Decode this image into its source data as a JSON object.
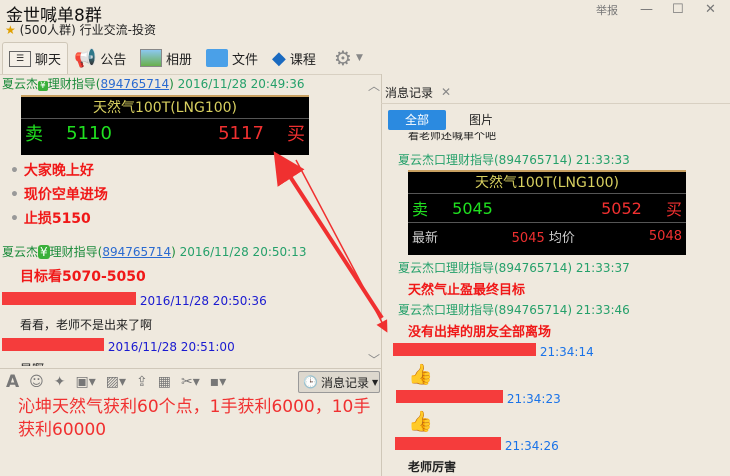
{
  "window": {
    "title": "金世喊单8群",
    "subtitle": "(500人群) 行业交流-投资",
    "report": "举报",
    "minimize": "—",
    "maximize": "☐",
    "close": "✕"
  },
  "toolbar": [
    {
      "label": "聊天",
      "icon": "chat-icon"
    },
    {
      "label": "公告",
      "icon": "megaphone-icon"
    },
    {
      "label": "相册",
      "icon": "album-icon"
    },
    {
      "label": "文件",
      "icon": "folder-icon"
    },
    {
      "label": "课程",
      "icon": "course-icon"
    }
  ],
  "left_chat": {
    "m1": {
      "name": "夏云杰",
      "title": "理财指导",
      "qq": "894765714",
      "time": "2016/11/28 20:49:36"
    },
    "quote1": {
      "title": "天然气100T(LNG100)",
      "sell_label": "卖",
      "sell": "5110",
      "buy": "5117",
      "buy_label": "买"
    },
    "lines1": [
      "大家晚上好",
      "现价空单进场",
      "止损5150"
    ],
    "m2": {
      "name": "夏云杰",
      "title": "理财指导",
      "qq": "894765714",
      "time": "2016/11/28 20:50:13",
      "text": "目标看5070-5050"
    },
    "m3": {
      "time": "2016/11/28 20:50:36",
      "text": "看看，老师不是出来了啊"
    },
    "m4": {
      "time": "2016/11/28 20:51:00",
      "text": "早啊"
    }
  },
  "input_toolbar": {
    "history_label": "消息记录"
  },
  "input_text": "沁坤天然气获利60个点，1手获利6000，10手获利60000",
  "right_panel": {
    "tab_label": "消息记录",
    "filter_all": "全部",
    "filter_images": "图片",
    "cut_text": "看老师还喊单个吧",
    "r1": "夏云杰口理财指导(894765714) 21:33:33",
    "quote2": {
      "title": "天然气100T(LNG100)",
      "sell_label": "卖",
      "sell": "5045",
      "buy": "5052",
      "buy_label": "买",
      "latest_label": "最新",
      "latest": "5045",
      "avg_label": "均价",
      "avg": "5048"
    },
    "r2": "夏云杰口理财指导(894765714) 21:33:37",
    "r2_text": "天然气止盈最终目标",
    "r3": "夏云杰口理财指导(894765714) 21:33:46",
    "r3_text": "没有出掉的朋友全部离场",
    "r4_time": "21:34:14",
    "r5_time": "21:34:23",
    "r6_time": "21:34:26",
    "r6_text": "老师厉害"
  }
}
